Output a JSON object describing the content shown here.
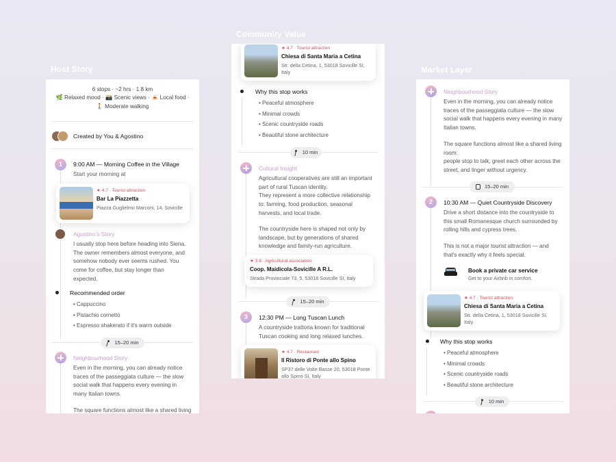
{
  "labels": {
    "host": "Host Story",
    "community": "Community Value",
    "market": "Market Layer"
  },
  "host": {
    "summary1": "6 stops · ~2 hrs · 1.8 km",
    "summary2": "🌿 Relaxed mood · 📸 Scenic views · 🍝 Local food ·",
    "summary3": "🚶 Moderate walking",
    "created": "Created by You & Agostino",
    "stop1_title": "9:00 AM — Morning Coffee in the Village",
    "stop1_sub": "Start your morning at",
    "card1": {
      "meta": "★ 4.7 · Tourist attraction",
      "name": "Bar La Piazzetta",
      "addr": "Piazza Guglielmo Marconi, 14, Sovicille"
    },
    "agostino_story": "Agostino's Story",
    "agostino_text": "I usually stop here before heading into Siena. The owner remembers almost everyone, and somehow nobody ever seems rushed. You come for coffee, but stay longer than expected.",
    "order_title": "Recommended order",
    "order_items": [
      "Cappuccino",
      "Pistachio cornetto",
      "Espresso shakerato if it's warm outside"
    ],
    "pill": "15–20 min",
    "neigh_title": "Neighbourhood Story",
    "neigh_text": "Even in the morning, you can already notice traces of the passeggiata culture — the slow social walk that happens every evening in many Italian towns.",
    "neigh_text2": "The square functions almost like a shared living"
  },
  "community": {
    "card1": {
      "meta": "★ 4.7 · Tourist attraction",
      "name": "Chiesa di Santa Maria a Cetina",
      "addr": "Str. della Cetina, 1, 53018 Sovicille SI, Italy"
    },
    "why_title": "Why this stop works",
    "why_items": [
      "Peaceful atmosphere",
      "Minimal crowds",
      "Scenic countryside roads",
      "Beautiful stone architecture"
    ],
    "pill1": "10 min",
    "insight_title": "Cultural Insight",
    "insight_text": "Agricultural cooperatives are still an important part of rural Tuscan identity.\nThey represent a more collective relationship to: farming, food production, seasonal harvests, and local trade.",
    "insight_text2": "The countryside here is shaped not only by landscape, but by generations of shared knowledge and family-run agriculture.",
    "card2": {
      "meta": "★ 3.8 · Agricultural association",
      "name": "Coop. Maidicola-Sovicille A R.L.",
      "addr": "Strada Provinciale 73, 5, 53018 Sovicille SI, Italy"
    },
    "pill2": "15–20 min",
    "stop3_title": "12:30 PM — Long Tuscan Lunch",
    "stop3_text": "A countryside trattoria known for traditional Tuscan cooking and long relaxed lunches.",
    "card3": {
      "meta": "★ 4.7 · Restaurant",
      "name": "Il Ristoro di Ponte allo Spino",
      "addr": "SP37 delle Volte Basse 20, 53018 Ponte allo Spino SI, Italy"
    }
  },
  "market": {
    "neigh_title": "Neighbourhood Story",
    "neigh_text": "Even in the morning, you can already notice traces of the passeggiata culture — the slow social walk that happens every evening in many Italian towns.",
    "neigh_text2": "The square functions almost like a shared living room:\npeople stop to talk, greet each other across the street, and linger without urgency.",
    "pill1": "15–20 min",
    "stop2_title": "10:30 AM — Quiet Countryside Discovery",
    "stop2_text": "Drive a short distance into the countryside to this small Romanesque church surrounded by rolling hills and cypress trees.",
    "stop2_text2": "This is not a major tourist attraction — and that's exactly why it feels special.",
    "car_title": "Book a private car service",
    "car_sub": "Get to your Airbnb in comfort.",
    "card1": {
      "meta": "★ 4.7 · Tourist attraction",
      "name": "Chiesa di Santa Maria a Cetina",
      "addr": "Str. della Cetina, 1, 53018 Sovicille SI, Italy"
    },
    "why_title": "Why this stop works",
    "why_items": [
      "Peaceful atmosphere",
      "Minimal crowds",
      "Scenic countryside roads",
      "Beautiful stone architecture"
    ],
    "pill2": "10 min"
  }
}
